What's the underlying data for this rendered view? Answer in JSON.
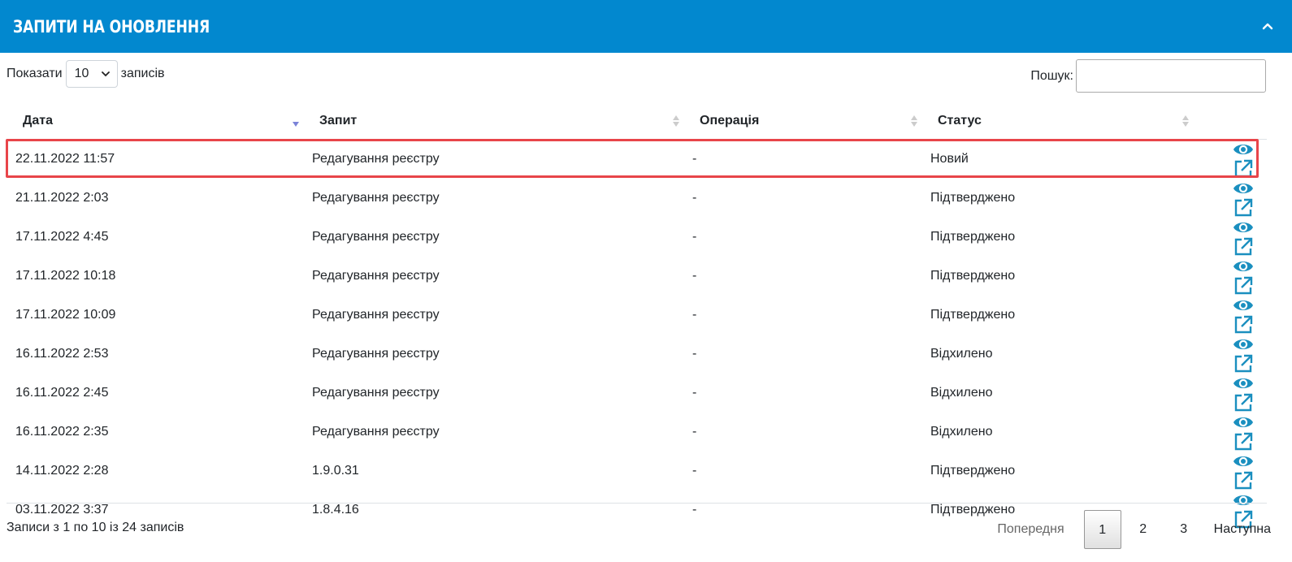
{
  "panel": {
    "title": "Запити на оновлення"
  },
  "length": {
    "prefix": "Показати",
    "value": "10",
    "suffix": "записів"
  },
  "search": {
    "label": "Пошук:",
    "value": ""
  },
  "columns": [
    "Дата",
    "Запит",
    "Операція",
    "Статус"
  ],
  "rows": [
    {
      "date": "22.11.2022 11:57",
      "request": "Редагування реєстру",
      "operation": "-",
      "status": "Новий"
    },
    {
      "date": "21.11.2022 2:03",
      "request": "Редагування реєстру",
      "operation": "-",
      "status": "Підтверджено"
    },
    {
      "date": "17.11.2022 4:45",
      "request": "Редагування реєстру",
      "operation": "-",
      "status": "Підтверджено"
    },
    {
      "date": "17.11.2022 10:18",
      "request": "Редагування реєстру",
      "operation": "-",
      "status": "Підтверджено"
    },
    {
      "date": "17.11.2022 10:09",
      "request": "Редагування реєстру",
      "operation": "-",
      "status": "Підтверджено"
    },
    {
      "date": "16.11.2022 2:53",
      "request": "Редагування реєстру",
      "operation": "-",
      "status": "Відхилено"
    },
    {
      "date": "16.11.2022 2:45",
      "request": "Редагування реєстру",
      "operation": "-",
      "status": "Відхилено"
    },
    {
      "date": "16.11.2022 2:35",
      "request": "Редагування реєстру",
      "operation": "-",
      "status": "Відхилено"
    },
    {
      "date": "14.11.2022 2:28",
      "request": "1.9.0.31",
      "operation": "-",
      "status": "Підтверджено"
    },
    {
      "date": "03.11.2022 3:37",
      "request": "1.8.4.16",
      "operation": "-",
      "status": "Підтверджено"
    }
  ],
  "footer": {
    "info": "Записи з 1 по 10 із 24 записів",
    "prev": "Попередня",
    "pages": [
      "1",
      "2",
      "3"
    ],
    "next": "Наступна"
  },
  "colors": {
    "header": "#0288cf",
    "icon": "#1a8fbf",
    "highlight": "#e8454a"
  }
}
